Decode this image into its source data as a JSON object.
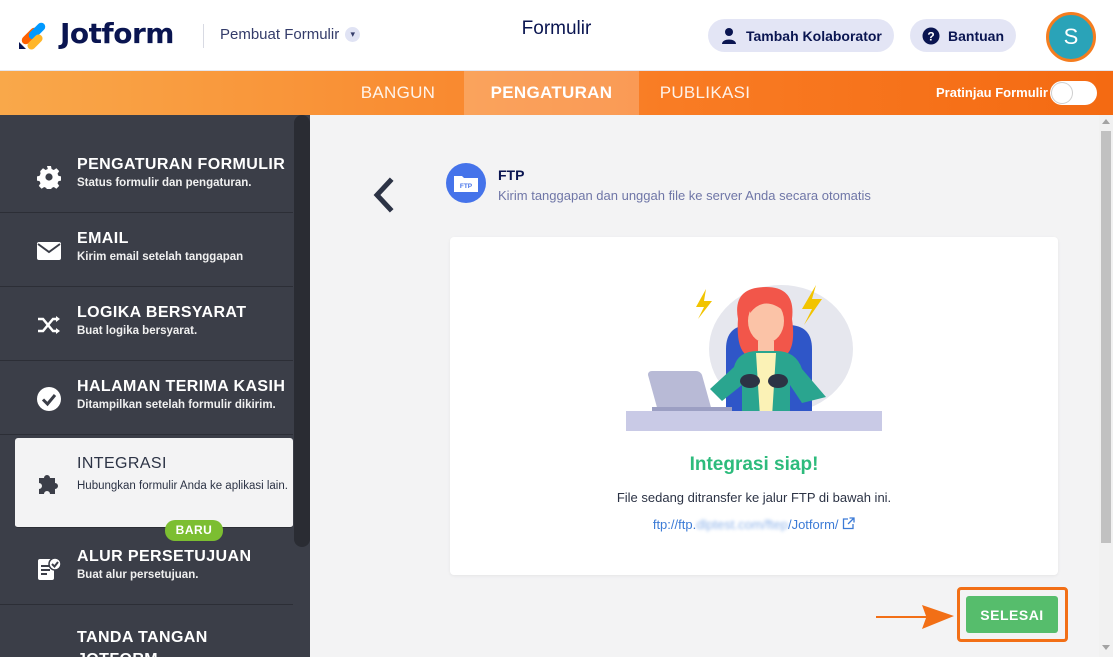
{
  "header": {
    "logo_text": "Jotform",
    "builder_label": "Pembuat Formulir",
    "form_title": "Formulir",
    "collaborator_label": "Tambah Kolaborator",
    "help_label": "Bantuan",
    "avatar_initial": "S",
    "icons": [
      "jotform-logo-icon",
      "chevron-down-icon",
      "user-icon",
      "help-icon"
    ]
  },
  "nav": {
    "tabs": [
      {
        "label": "BANGUN",
        "active": false
      },
      {
        "label": "PENGATURAN",
        "active": true
      },
      {
        "label": "PUBLIKASI",
        "active": false
      }
    ],
    "preview_label": "Pratinjau Formulir",
    "preview_on": false
  },
  "sidebar": {
    "items": [
      {
        "title": "PENGATURAN FORMULIR",
        "desc": "Status formulir dan pengaturan.",
        "icon": "gear-icon"
      },
      {
        "title": "EMAIL",
        "desc": "Kirim email setelah tanggapan",
        "icon": "envelope-icon"
      },
      {
        "title": "LOGIKA BERSYARAT",
        "desc": "Buat logika bersyarat.",
        "icon": "shuffle-icon"
      },
      {
        "title": "HALAMAN TERIMA KASIH",
        "desc": "Ditampilkan setelah formulir dikirim.",
        "icon": "check-circle-icon"
      },
      {
        "title": "INTEGRASI",
        "desc": "Hubungkan formulir Anda ke aplikasi lain.",
        "icon": "puzzle-icon",
        "active": true
      },
      {
        "title": "ALUR PERSETUJUAN",
        "desc": "Buat alur persetujuan.",
        "icon": "approval-icon"
      },
      {
        "title": "TANDA TANGAN JOTFORM",
        "desc": "",
        "icon": "signature-icon"
      }
    ],
    "new_badge": "BARU"
  },
  "main": {
    "integration_name": "FTP",
    "integration_icon_label": "FTP",
    "integration_desc": "Kirim tanggapan dan unggah file ke server Anda secara otomatis",
    "ready_title": "Integrasi siap!",
    "transfer_text": "File sedang ditransfer ke jalur FTP di bawah ini.",
    "ftp_link_prefix": "ftp://ftp.",
    "ftp_link_blurred": "dlptest.com/ftep",
    "ftp_link_suffix": "/Jotform/",
    "done_label": "SELESAI"
  },
  "colors": {
    "brand_navy": "#0a1551",
    "nav_orange": "#f97c24",
    "sidebar_dark": "#3b3e48",
    "success_green": "#2dbb7c",
    "done_button": "#56bd6c",
    "highlight_orange": "#f26f16",
    "ftp_blue": "#4573ea"
  }
}
